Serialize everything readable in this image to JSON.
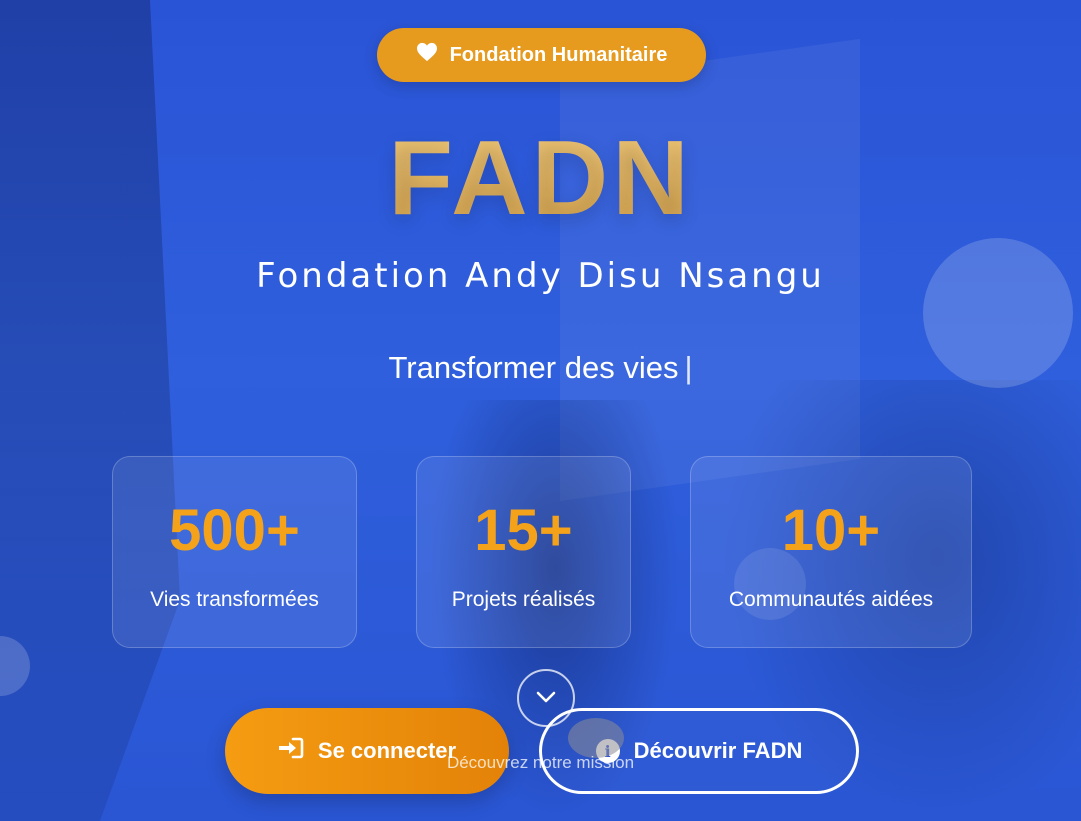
{
  "badge": {
    "icon": "heart-icon",
    "label": "Fondation Humanitaire",
    "color": "#e69a1e"
  },
  "hero": {
    "title": "FADN",
    "subtitle": "Fondation Andy Disu Nsangu",
    "tagline": "Transformer des vies",
    "typing_cursor": "|"
  },
  "stats": [
    {
      "value": "500+",
      "label": "Vies transformées"
    },
    {
      "value": "15+",
      "label": "Projets réalisés"
    },
    {
      "value": "10+",
      "label": "Communautés aidées"
    }
  ],
  "actions": {
    "login": {
      "icon": "sign-in-icon",
      "label": "Se connecter"
    },
    "discover": {
      "icon": "info-icon",
      "label": "Découvrir FADN",
      "icon_glyph": "i"
    }
  },
  "scroll": {
    "icon": "chevron-down-icon",
    "hint": "Découvrez notre mission"
  },
  "colors": {
    "accent": "#f4a21a",
    "background": "#2f5fdc",
    "title_gold": "#e0b060"
  }
}
